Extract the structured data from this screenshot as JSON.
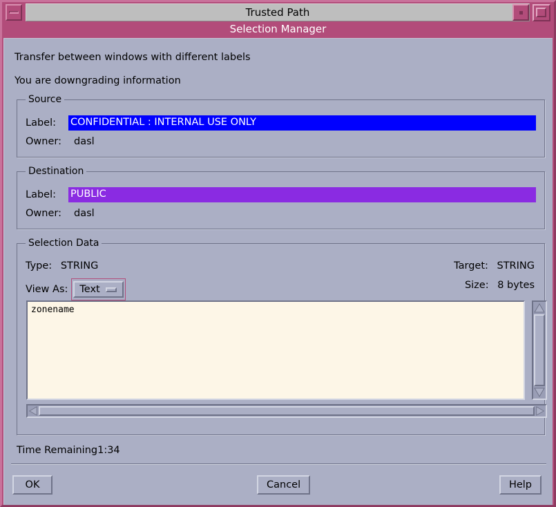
{
  "titlebar": {
    "trusted_path_title": "Trusted Path",
    "minimize_icon": "minimize-bar-icon",
    "restore_icon": "restore-square-icon",
    "maximize_icon": "maximize-square-icon"
  },
  "dialog": {
    "title": "Selection Manager",
    "intro_line1": "Transfer between windows with different labels",
    "intro_line2": "You are downgrading information"
  },
  "source": {
    "group_label": "Source",
    "label_caption": "Label:",
    "label_value": "CONFIDENTIAL : INTERNAL USE ONLY",
    "label_bg": "#0000ff",
    "label_fg": "#ffffff",
    "owner_caption": "Owner:",
    "owner_value": "dasl"
  },
  "destination": {
    "group_label": "Destination",
    "label_caption": "Label:",
    "label_value": "PUBLIC",
    "label_bg": "#8a2be2",
    "label_fg": "#ffffff",
    "owner_caption": "Owner:",
    "owner_value": "dasl"
  },
  "selection_data": {
    "group_label": "Selection Data",
    "type_caption": "Type:",
    "type_value": "STRING",
    "target_caption": "Target:",
    "target_value": "STRING",
    "size_caption": "Size:",
    "size_value": "8 bytes",
    "view_as_caption": "View As:",
    "view_as_value": "Text",
    "view_as_options": [
      "Text"
    ],
    "content": "zonename",
    "vscroll_up_icon": "scroll-up-arrow-icon",
    "vscroll_down_icon": "scroll-down-arrow-icon",
    "hscroll_left_icon": "scroll-left-arrow-icon",
    "hscroll_right_icon": "scroll-right-arrow-icon"
  },
  "status": {
    "time_remaining_caption": "Time Remaining",
    "time_remaining_value": "1:34"
  },
  "actions": {
    "ok": "OK",
    "cancel": "Cancel",
    "help": "Help"
  },
  "colors": {
    "window_bg": "#abafc5",
    "trusted_path_pink": "#b24c7a",
    "title_grey": "#bebebe",
    "textarea_bg": "#fdf6e7"
  }
}
